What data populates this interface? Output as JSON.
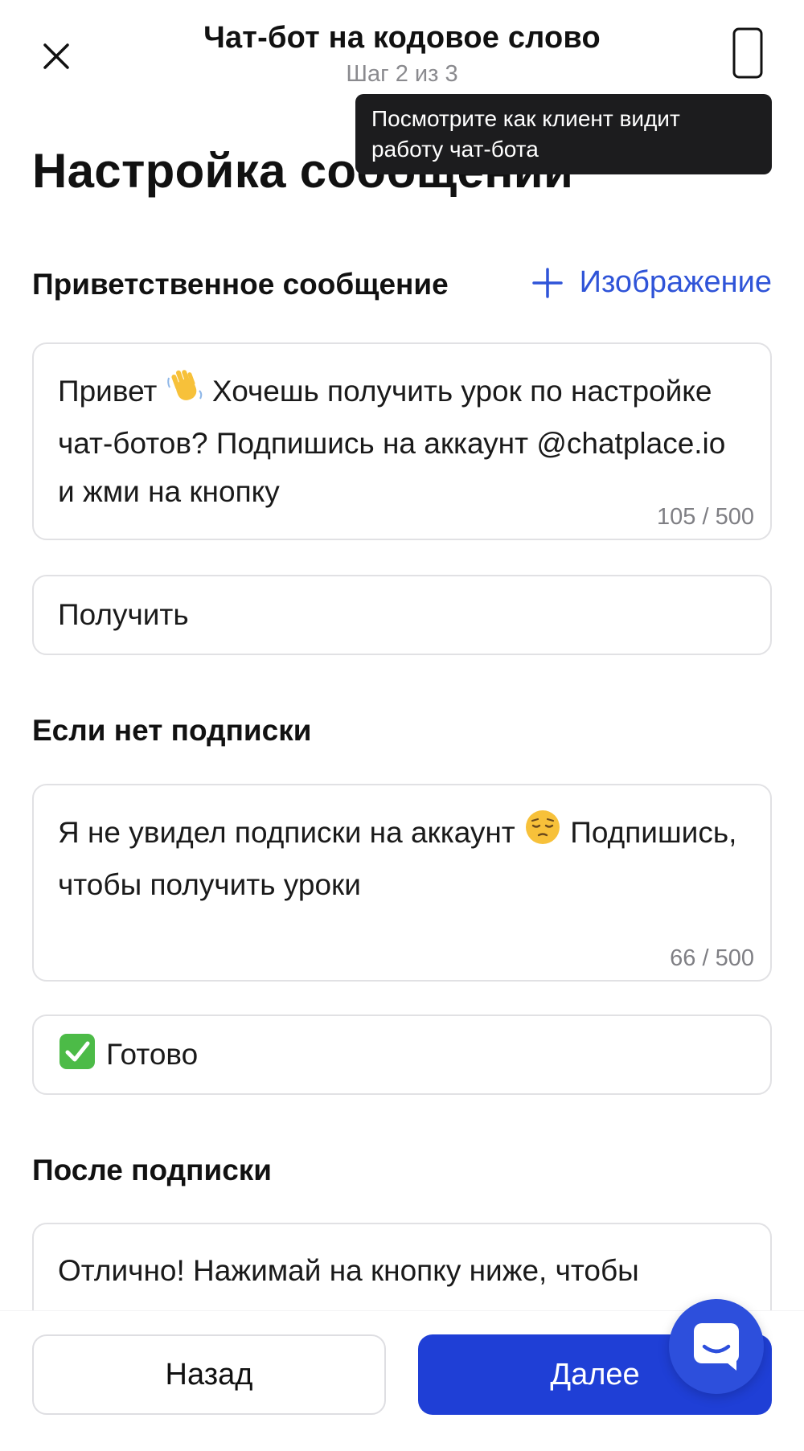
{
  "header": {
    "title": "Чат-бот на кодовое слово",
    "step": "Шаг 2 из 3",
    "close_icon": "close-icon",
    "preview_icon": "phone-icon"
  },
  "tooltip": {
    "text": "Посмотрите как клиент видит работу чат-бота"
  },
  "page_title": "Настройка сообщений",
  "welcome": {
    "label": "Приветственное сообщение",
    "add_image_label": "Изображение",
    "text_before_emoji": "Привет ",
    "text_after_emoji": " Хочешь получить урок по настройке чат-ботов? Подпишись на аккаунт @chatplace.io и жми на кнопку",
    "counter": "105 / 500",
    "button_value": "Получить"
  },
  "no_subscription": {
    "label": "Если нет подписки",
    "text_before_emoji": "Я не увидел подписки на аккаунт ",
    "text_after_emoji": " Подпишись, чтобы получить уроки",
    "counter": "66 / 500",
    "button_value": "Готово"
  },
  "after_subscription": {
    "label": "После подписки",
    "text": "Отлично! Нажимай на кнопку ниже, чтобы приступить к просмотру уроков"
  },
  "footer": {
    "back_label": "Назад",
    "next_label": "Далее",
    "chat_icon": "chat-icon"
  },
  "colors": {
    "accent": "#1f3fd6",
    "link": "#2f54d8",
    "tooltip_bg": "#1c1c1e"
  }
}
